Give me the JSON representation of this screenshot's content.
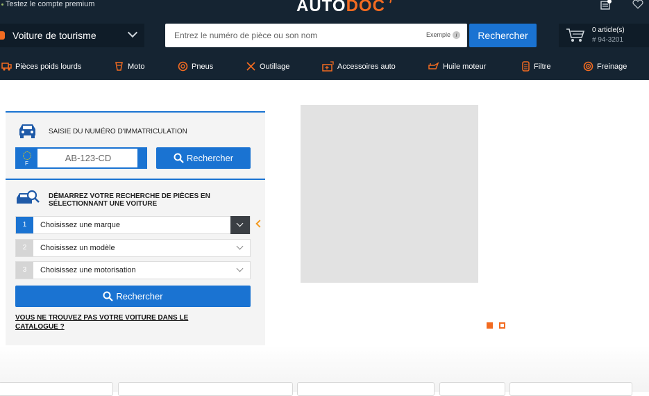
{
  "header": {
    "premium_text": "Testez le compte premium",
    "logo_main": "AUTO",
    "logo_accent": "DOC",
    "vehicle_type": "Voiture de tourisme",
    "search_placeholder": "Entrez le numéro de pièce ou son nom",
    "example_label": "Exemple",
    "search_button": "Rechercher",
    "cart_count": "0 article(s)",
    "cart_number": "# 94-3201"
  },
  "categories": [
    {
      "label": "Pièces poids lourds",
      "icon": "truck-icon"
    },
    {
      "label": "Moto",
      "icon": "motorcycle-icon"
    },
    {
      "label": "Pneus",
      "icon": "tire-icon"
    },
    {
      "label": "Outillage",
      "icon": "tools-icon"
    },
    {
      "label": "Accessoires auto",
      "icon": "accessories-icon"
    },
    {
      "label": "Huile moteur",
      "icon": "oil-can-icon"
    },
    {
      "label": "Filtre",
      "icon": "filter-icon"
    },
    {
      "label": "Freinage",
      "icon": "brake-disc-icon"
    }
  ],
  "plate_search": {
    "title": "SAISIE DU NUMÉRO D'IMMATRICULATION",
    "plate_placeholder": "AB-123-CD",
    "country_letter": "F",
    "button": "Rechercher"
  },
  "car_search": {
    "title": "DÉMARREZ VOTRE RECHERCHE DE PIÈCES EN SÉLECTIONNANT UNE VOITURE",
    "steps": [
      {
        "num": "1",
        "label": "Choisissez une marque"
      },
      {
        "num": "2",
        "label": "Choisissez un modèle"
      },
      {
        "num": "3",
        "label": "Choisissez une motorisation"
      }
    ],
    "button": "Rechercher",
    "not_found_link": "VOUS NE TROUVEZ PAS VOTRE VOITURE DANS LE CATALOGUE ?"
  },
  "colors": {
    "header_bg": "#152432",
    "accent_blue": "#1a73d2",
    "accent_orange": "#f26b21"
  }
}
